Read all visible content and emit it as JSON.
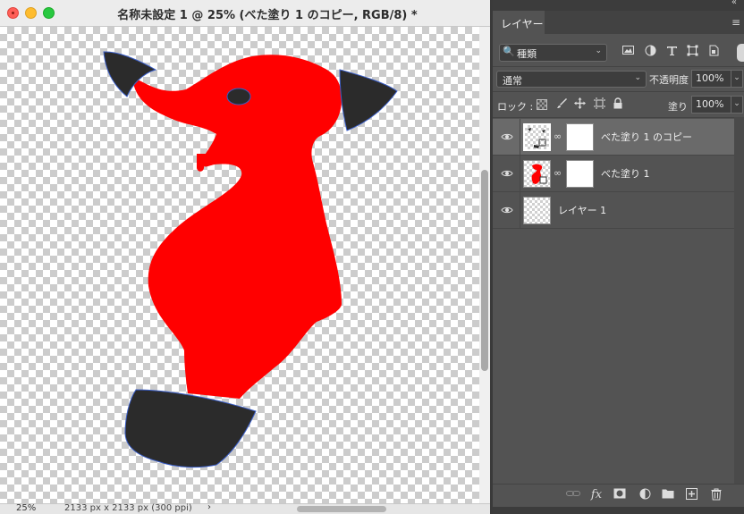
{
  "document": {
    "title": "名称未設定 1 @ 25% (べた塗り 1 のコピー, RGB/8) *",
    "zoom": "25%",
    "doc_size": "2133 px x 2133 px (300 ppi)",
    "status_arrow": "›"
  },
  "colors": {
    "shape_fill": "#ff0000",
    "accent_dark": "#2b2b2b",
    "panel_bg": "#535353"
  },
  "panel": {
    "tab_label": "レイヤー",
    "collapse_icon": "«",
    "menu_icon": "≡",
    "filter": {
      "icon": "🔍",
      "label": "種類",
      "arrow": "⌄"
    },
    "filter_icons": [
      "image-filter-icon",
      "adjustment-filter-icon",
      "type-filter-icon",
      "shape-filter-icon",
      "smart-object-filter-icon"
    ],
    "blend_mode": "通常",
    "opacity_label": "不透明度 :",
    "opacity_value": "100%",
    "lock_label": "ロック :",
    "fill_label": "塗り :",
    "fill_value": "100%",
    "dropdown_arrow": "⌄"
  },
  "layers": [
    {
      "name": "べた塗り 1 のコピー",
      "selected": true,
      "has_mask": true
    },
    {
      "name": "べた塗り 1",
      "selected": false,
      "has_mask": true
    },
    {
      "name": "レイヤー 1",
      "selected": false,
      "has_mask": false
    }
  ],
  "bottom_icons": [
    "link-layers-icon",
    "fx-icon",
    "add-mask-icon",
    "adjustment-layer-icon",
    "new-group-icon",
    "new-layer-icon",
    "trash-icon"
  ]
}
